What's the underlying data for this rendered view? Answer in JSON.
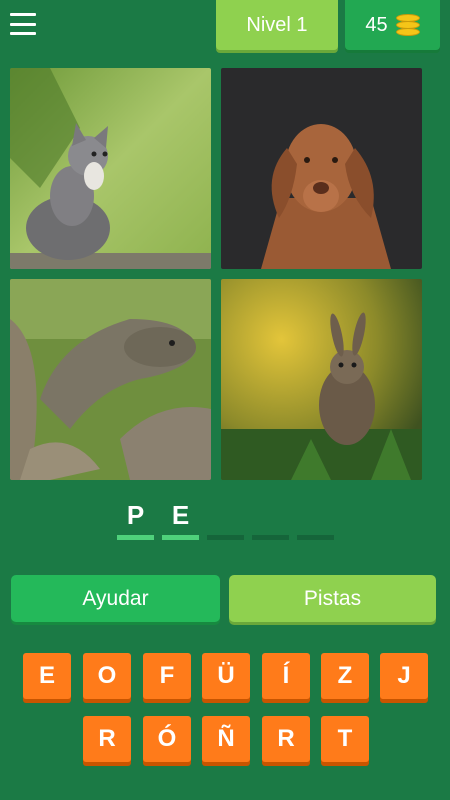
{
  "header": {
    "menu_icon": "hamburger-menu-icon",
    "level_label": "Nivel 1",
    "coins": "45",
    "coins_icon": "coin-stack-icon"
  },
  "photos": [
    {
      "subject": "kitten-photo"
    },
    {
      "subject": "dog-photo"
    },
    {
      "subject": "tortoise-photo"
    },
    {
      "subject": "rabbit-photo"
    }
  ],
  "answer": {
    "slots": [
      "P",
      "E",
      "",
      "",
      ""
    ]
  },
  "actions": {
    "help_label": "Ayudar",
    "hints_label": "Pistas"
  },
  "keyboard": {
    "row1": [
      "E",
      "O",
      "F",
      "Ü",
      "Í",
      "Z",
      "J"
    ],
    "row2": [
      "R",
      "Ó",
      "Ñ",
      "R",
      "T"
    ]
  },
  "colors": {
    "background": "#1b7a45",
    "key": "#ff7b1a",
    "level_badge": "#8fd14f",
    "coins_badge": "#22a852",
    "help_button": "#24b95a",
    "hints_button": "#8fd14f"
  }
}
